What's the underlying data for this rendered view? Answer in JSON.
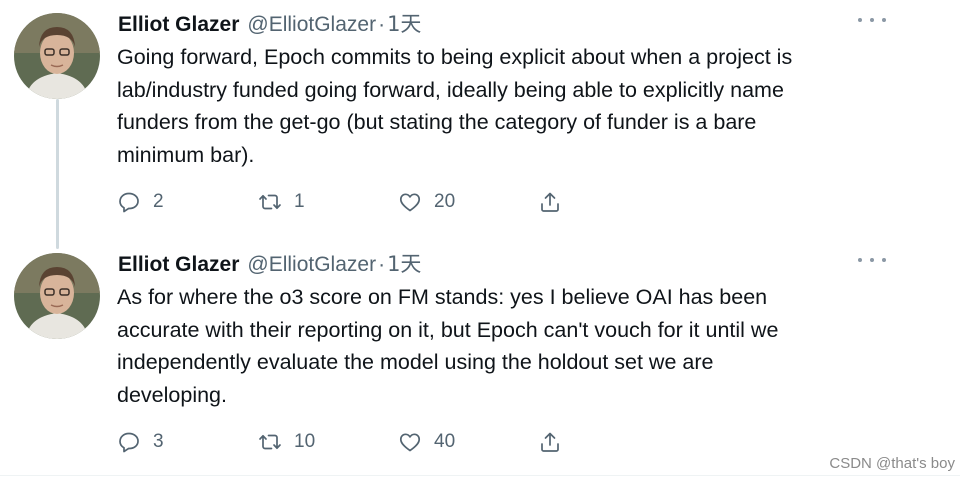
{
  "tweets": [
    {
      "author_name": "Elliot Glazer",
      "handle": "@ElliotGlazer",
      "separator": "·",
      "time": "1天",
      "text": "Going forward, Epoch commits to being explicit about when a project is\nlab/industry funded going forward, ideally being able to explicitly name\nfunders from the get-go (but stating the category of funder is a bare\nminimum bar).",
      "replies": "2",
      "retweets": "1",
      "likes": "20",
      "icons": [
        "avatar-photo",
        "more-icon",
        "reply-icon",
        "retweet-icon",
        "like-icon",
        "share-icon"
      ]
    },
    {
      "author_name": "Elliot Glazer",
      "handle": "@ElliotGlazer",
      "separator": "·",
      "time": "1天",
      "text": "As for where the o3 score on FM stands: yes I believe OAI has been\naccurate with their reporting on it, but Epoch can't vouch for it until we\nindependently evaluate the model using the holdout set we are\ndeveloping.",
      "replies": "3",
      "retweets": "10",
      "likes": "40",
      "icons": [
        "avatar-photo",
        "more-icon",
        "reply-icon",
        "retweet-icon",
        "like-icon",
        "share-icon"
      ]
    }
  ],
  "watermark": "CSDN @that's boy",
  "colors": {
    "text": "#0f1419",
    "muted": "#536471",
    "thread_line": "#cfd9de"
  }
}
